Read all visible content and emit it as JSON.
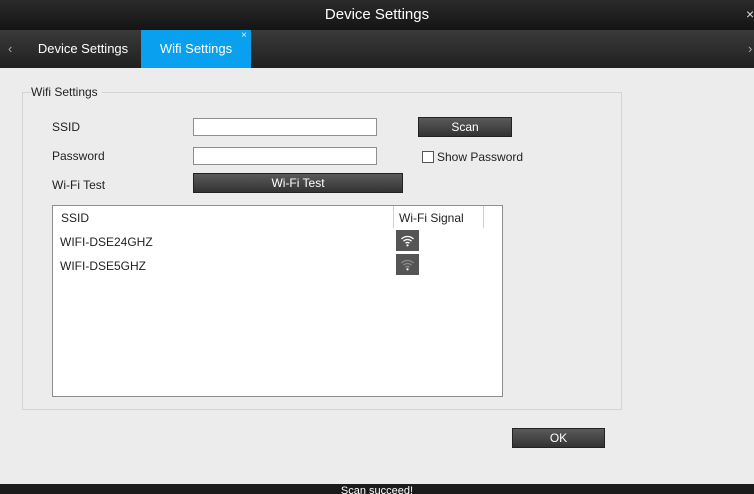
{
  "window": {
    "title": "Device Settings",
    "close_glyph": "×"
  },
  "tabs": {
    "prev_glyph": "‹",
    "next_glyph": "›",
    "items": [
      {
        "label": "Device Settings",
        "active": false
      },
      {
        "label": "Wifi Settings",
        "active": true,
        "close_glyph": "×"
      }
    ]
  },
  "wifi": {
    "group_title": "Wifi Settings",
    "ssid_label": "SSID",
    "ssid_value": "",
    "password_label": "Password",
    "password_value": "",
    "wifi_test_label": "Wi-Fi Test",
    "scan_button": "Scan",
    "wifi_test_button": "Wi-Fi Test",
    "show_password_label": "Show Password",
    "show_password_checked": false
  },
  "networks": {
    "headers": {
      "ssid": "SSID",
      "signal": "Wi-Fi Signal"
    },
    "rows": [
      {
        "ssid": "WIFI-DSE24GHZ",
        "signal_icon": "wifi-strong-icon"
      },
      {
        "ssid": "WIFI-DSE5GHZ",
        "signal_icon": "wifi-weak-icon"
      }
    ]
  },
  "footer": {
    "ok_button": "OK",
    "status": "Scan succeed!"
  },
  "colors": {
    "accent": "#0aa0f0",
    "bar_dark": "#1b1b1b",
    "background": "#ececec"
  }
}
